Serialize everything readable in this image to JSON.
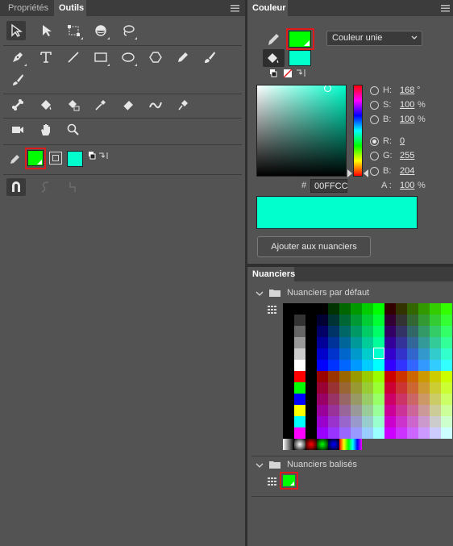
{
  "left_panel": {
    "tabs": [
      {
        "label": "Propriétés",
        "active": false
      },
      {
        "label": "Outils",
        "active": true
      }
    ],
    "menu_icon": "hamburger-icon",
    "tools_rows": [
      [
        "selection-arrow-icon",
        "subselection-arrow-icon",
        "free-transform-icon",
        "3d-rotation-icon",
        "lasso-icon"
      ],
      [
        "pen-icon",
        "text-icon",
        "line-icon",
        "rectangle-icon",
        "oval-icon",
        "polystar-icon",
        "pencil-icon",
        "brush-icon"
      ],
      [
        "paint-brush-icon"
      ],
      [
        "bone-icon",
        "paint-bucket-icon",
        "ink-bottle-icon",
        "eyedropper-icon",
        "eraser-icon",
        "width-icon",
        "pin-icon"
      ],
      [
        "camera-icon",
        "hand-icon",
        "zoom-icon"
      ]
    ],
    "stroke_color": "#00FF00",
    "fill_color": "#00FFCC"
  },
  "color_panel": {
    "tab": "Couleur",
    "mode": "Couleur unie",
    "stroke_color": "#00FF00",
    "fill_color": "#00FFCC",
    "fields": {
      "h": {
        "label": "H:",
        "value": "168",
        "unit": "°"
      },
      "s": {
        "label": "S:",
        "value": "100",
        "unit": "%"
      },
      "b": {
        "label": "B:",
        "value": "100",
        "unit": "%"
      },
      "r": {
        "label": "R:",
        "value": "0"
      },
      "g": {
        "label": "G:",
        "value": "255"
      },
      "bl": {
        "label": "B:",
        "value": "204"
      },
      "a": {
        "label": "A :",
        "value": "100",
        "unit": "%"
      }
    },
    "hex_prefix": "#",
    "hex": "00FFCC",
    "add_button": "Ajouter aux nuanciers"
  },
  "swatches_panel": {
    "tab": "Nuanciers",
    "default_group": "Nuanciers par défaut",
    "tagged_group": "Nuanciers balisés",
    "tagged_swatch": "#00FF00"
  }
}
